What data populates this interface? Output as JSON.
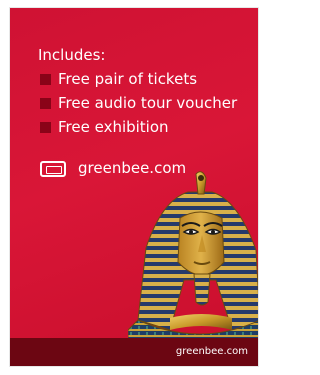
{
  "promo": {
    "title": "Includes:",
    "items": [
      {
        "label": "Free pair of tickets"
      },
      {
        "label": "Free audio tour voucher"
      },
      {
        "label": "Free exhibition"
      }
    ],
    "website": "greenbee.com",
    "footer_text": "greenbee.com",
    "colors": {
      "background": "#d91637",
      "bullet": "#8a0318",
      "footer": "#6c0612",
      "text": "#ffffff"
    },
    "icons": {
      "ticket": "ticket-icon",
      "image": "tutankhamun-mask"
    }
  }
}
